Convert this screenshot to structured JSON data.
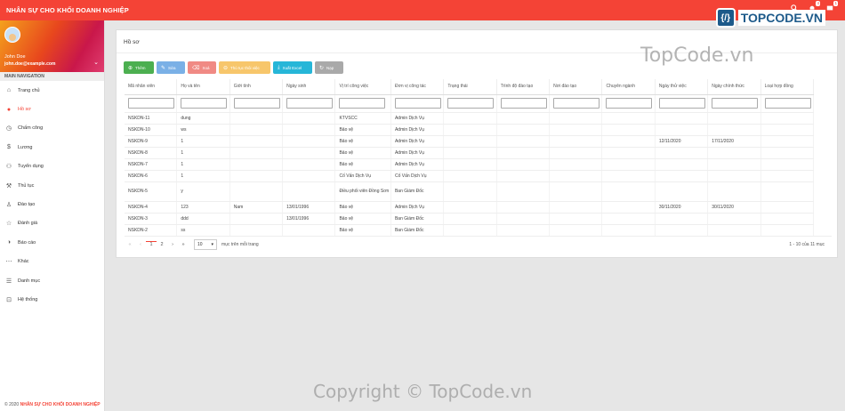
{
  "app": {
    "title": "NHÂN SỰ CHO KHỐI DOANH NGHIỆP"
  },
  "topbar": {
    "notif_count": "4",
    "msg_count": "1",
    "logo_text": "TOPCODE.VN"
  },
  "profile": {
    "name": "John Doe",
    "email": "john.doe@example.com"
  },
  "nav": {
    "header": "MAIN NAVIGATION",
    "items": [
      {
        "label": "Trang chủ",
        "icon": "home-icon"
      },
      {
        "label": "Hồ sơ",
        "icon": "person-icon"
      },
      {
        "label": "Chấm công",
        "icon": "clock-icon"
      },
      {
        "label": "Lương",
        "icon": "money-icon"
      },
      {
        "label": "Tuyển dụng",
        "icon": "people-add-icon"
      },
      {
        "label": "Thủ tục",
        "icon": "gavel-icon"
      },
      {
        "label": "Đào tạo",
        "icon": "training-icon"
      },
      {
        "label": "Đánh giá",
        "icon": "star-icon"
      },
      {
        "label": "Báo cáo",
        "icon": "report-icon"
      },
      {
        "label": "Khác",
        "icon": "more-icon"
      },
      {
        "label": "Danh mục",
        "icon": "list-icon"
      },
      {
        "label": "Hệ thống",
        "icon": "system-icon"
      }
    ]
  },
  "footer": {
    "year": "© 2020",
    "brand": "NHÂN SỰ CHO KHỐI DOANH NGHIỆP"
  },
  "page": {
    "title": "Hồ sơ"
  },
  "toolbar": {
    "add": "Thêm",
    "edit": "Sửa",
    "delete": "Xoá",
    "procedure": "Thủ tục thôi việc",
    "export": "Xuất Excel",
    "reload": "Nạp"
  },
  "table": {
    "headers": [
      "Mã nhân viên",
      "Họ và tên",
      "Giới tính",
      "Ngày sinh",
      "Vị trí công việc",
      "Đơn vị công tác",
      "Trạng thái",
      "Trình độ đào tạo",
      "Nơi đào tạo",
      "Chuyên ngành",
      "Ngày thử việc",
      "Ngày chính thức",
      "Loại hợp đồng"
    ],
    "rows": [
      [
        "NSKDN-11",
        "dung",
        "",
        "",
        "KTVSCC",
        "Admin Dịch Vụ",
        "",
        "",
        "",
        "",
        "",
        "",
        ""
      ],
      [
        "NSKDN-10",
        "ws",
        "",
        "",
        "Bảo vệ",
        "Admin Dịch Vụ",
        "",
        "",
        "",
        "",
        "",
        "",
        ""
      ],
      [
        "NSKDN-9",
        "1",
        "",
        "",
        "Bảo vệ",
        "Admin Dịch Vụ",
        "",
        "",
        "",
        "",
        "12/11/2020",
        "17/11/2020",
        ""
      ],
      [
        "NSKDN-8",
        "1",
        "",
        "",
        "Bảo vệ",
        "Admin Dịch Vụ",
        "",
        "",
        "",
        "",
        "",
        "",
        ""
      ],
      [
        "NSKDN-7",
        "1",
        "",
        "",
        "Bảo vệ",
        "Admin Dịch Vụ",
        "",
        "",
        "",
        "",
        "",
        "",
        ""
      ],
      [
        "NSKDN-6",
        "1",
        "",
        "",
        "Cố Vấn Dịch Vụ",
        "Cố Vấn Dịch Vụ",
        "",
        "",
        "",
        "",
        "",
        "",
        ""
      ],
      [
        "NSKDN-5",
        "y",
        "",
        "",
        "Điều phối viên Đồng Sơn",
        "Ban Giám Đốc",
        "",
        "",
        "",
        "",
        "",
        "",
        ""
      ],
      [
        "NSKDN-4",
        "123",
        "Nam",
        "13/01/1996",
        "Bảo vệ",
        "Admin Dịch Vụ",
        "",
        "",
        "",
        "",
        "30/11/2020",
        "30/11/2020",
        ""
      ],
      [
        "NSKDN-3",
        "ddd",
        "",
        "13/01/1996",
        "Bảo vệ",
        "Ban Giám Đốc",
        "",
        "",
        "",
        "",
        "",
        "",
        ""
      ],
      [
        "NSKDN-2",
        "ss",
        "",
        "",
        "Bảo vệ",
        "Ban Giám Đốc",
        "",
        "",
        "",
        "",
        "",
        "",
        ""
      ]
    ]
  },
  "pager": {
    "page1": "1",
    "page2": "2",
    "page_size": "10",
    "per_page_label": "mục trên mỗi trang",
    "range": "1 - 10 của 11 mục"
  },
  "watermarks": {
    "top": "TopCode.vn",
    "bottom": "Copyright © TopCode.vn"
  },
  "colors": {
    "primary": "#f44336",
    "add": "#4caf50",
    "edit": "#7ab0e6",
    "delete": "#f08a84",
    "procedure": "#f7c66b",
    "export": "#26b6d8",
    "reload": "#a9a9a9"
  }
}
